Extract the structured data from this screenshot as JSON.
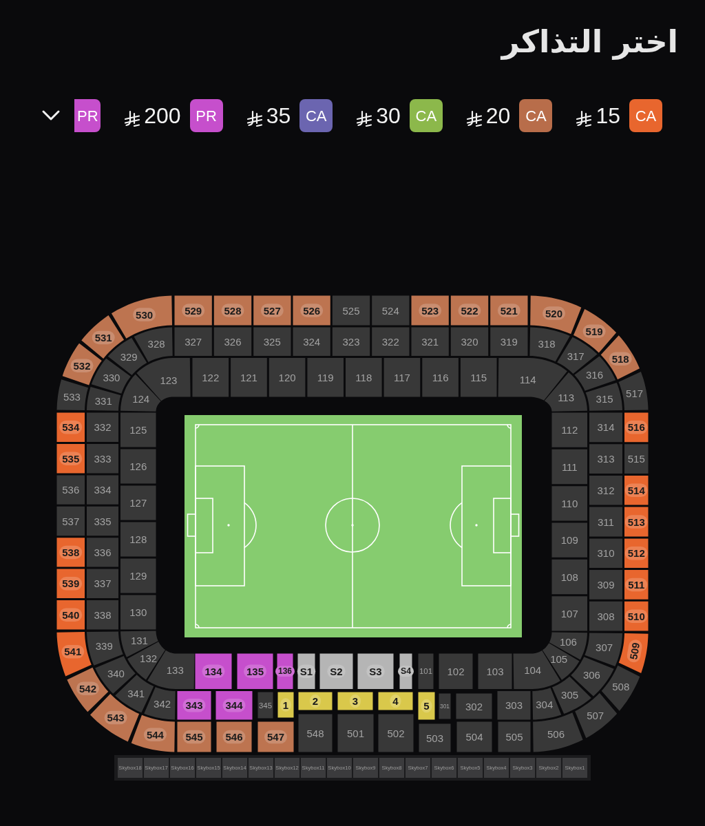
{
  "title": "اختر التذاكر",
  "price_filters": [
    {
      "tag": "PR",
      "color": "#c64fcc"
    },
    {
      "tag": "PR",
      "price": "200",
      "color": "#c64fcc"
    },
    {
      "tag": "CA",
      "price": "35",
      "color": "#6b65b0"
    },
    {
      "tag": "CA",
      "price": "30",
      "color": "#8cb84b"
    },
    {
      "tag": "CA",
      "price": "20",
      "color": "#b86d4a"
    },
    {
      "tag": "CA",
      "price": "15",
      "color": "#e8662e"
    }
  ],
  "seat_map": {
    "sections": [
      {
        "label": "533",
        "available": false,
        "color": "#383838"
      },
      {
        "label": "532",
        "available": true,
        "color": "#bd7450"
      },
      {
        "label": "531",
        "available": true,
        "color": "#bd7450"
      },
      {
        "label": "530",
        "available": true,
        "color": "#bd7450"
      },
      {
        "label": "529",
        "available": true,
        "color": "#bd7450"
      },
      {
        "label": "528",
        "available": true,
        "color": "#bd7450"
      },
      {
        "label": "527",
        "available": true,
        "color": "#bd7450"
      },
      {
        "label": "526",
        "available": true,
        "color": "#bd7450"
      },
      {
        "label": "525",
        "available": false,
        "color": "#383838"
      },
      {
        "label": "524",
        "available": false,
        "color": "#383838"
      },
      {
        "label": "523",
        "available": true,
        "color": "#bd7450"
      },
      {
        "label": "522",
        "available": true,
        "color": "#bd7450"
      },
      {
        "label": "521",
        "available": true,
        "color": "#bd7450"
      },
      {
        "label": "520",
        "available": true,
        "color": "#bd7450"
      },
      {
        "label": "519",
        "available": true,
        "color": "#bd7450"
      },
      {
        "label": "518",
        "available": true,
        "color": "#bd7450"
      },
      {
        "label": "517",
        "available": false,
        "color": "#383838"
      },
      {
        "label": "534",
        "available": true,
        "color": "#e8662e"
      },
      {
        "label": "535",
        "available": true,
        "color": "#e8662e"
      },
      {
        "label": "536",
        "available": false,
        "color": "#383838"
      },
      {
        "label": "537",
        "available": false,
        "color": "#383838"
      },
      {
        "label": "538",
        "available": true,
        "color": "#e8662e"
      },
      {
        "label": "539",
        "available": true,
        "color": "#e8662e"
      },
      {
        "label": "540",
        "available": true,
        "color": "#e8662e"
      },
      {
        "label": "516",
        "available": true,
        "color": "#e8662e"
      },
      {
        "label": "515",
        "available": false,
        "color": "#383838"
      },
      {
        "label": "514",
        "available": true,
        "color": "#e8662e"
      },
      {
        "label": "513",
        "available": true,
        "color": "#e8662e"
      },
      {
        "label": "512",
        "available": true,
        "color": "#e8662e"
      },
      {
        "label": "511",
        "available": true,
        "color": "#e8662e"
      },
      {
        "label": "510",
        "available": true,
        "color": "#e8662e"
      },
      {
        "label": "541",
        "available": true,
        "color": "#e8662e"
      },
      {
        "label": "542",
        "available": true,
        "color": "#bd7450"
      },
      {
        "label": "543",
        "available": true,
        "color": "#bd7450"
      },
      {
        "label": "544",
        "available": true,
        "color": "#bd7450"
      },
      {
        "label": "545",
        "available": true,
        "color": "#bd7450"
      },
      {
        "label": "546",
        "available": true,
        "color": "#bd7450"
      },
      {
        "label": "547",
        "available": true,
        "color": "#bd7450"
      },
      {
        "label": "548",
        "available": false,
        "color": "#383838"
      },
      {
        "label": "501",
        "available": false,
        "color": "#383838"
      },
      {
        "label": "502",
        "available": false,
        "color": "#383838"
      },
      {
        "label": "503",
        "available": false,
        "color": "#383838"
      },
      {
        "label": "504",
        "available": false,
        "color": "#383838"
      },
      {
        "label": "505",
        "available": false,
        "color": "#383838"
      },
      {
        "label": "506",
        "available": false,
        "color": "#383838"
      },
      {
        "label": "507",
        "available": false,
        "color": "#383838"
      },
      {
        "label": "508",
        "available": false,
        "color": "#383838"
      },
      {
        "label": "509",
        "available": true,
        "color": "#e8662e"
      },
      {
        "label": "331",
        "available": false,
        "color": "#383838"
      },
      {
        "label": "330",
        "available": false,
        "color": "#383838"
      },
      {
        "label": "329",
        "available": false,
        "color": "#383838"
      },
      {
        "label": "328",
        "available": false,
        "color": "#383838"
      },
      {
        "label": "327",
        "available": false,
        "color": "#383838"
      },
      {
        "label": "326",
        "available": false,
        "color": "#383838"
      },
      {
        "label": "325",
        "available": false,
        "color": "#383838"
      },
      {
        "label": "324",
        "available": false,
        "color": "#383838"
      },
      {
        "label": "323",
        "available": false,
        "color": "#383838"
      },
      {
        "label": "322",
        "available": false,
        "color": "#383838"
      },
      {
        "label": "321",
        "available": false,
        "color": "#383838"
      },
      {
        "label": "320",
        "available": false,
        "color": "#383838"
      },
      {
        "label": "319",
        "available": false,
        "color": "#383838"
      },
      {
        "label": "318",
        "available": false,
        "color": "#383838"
      },
      {
        "label": "317",
        "available": false,
        "color": "#383838"
      },
      {
        "label": "316",
        "available": false,
        "color": "#383838"
      },
      {
        "label": "315",
        "available": false,
        "color": "#383838"
      },
      {
        "label": "332",
        "available": false,
        "color": "#383838"
      },
      {
        "label": "333",
        "available": false,
        "color": "#383838"
      },
      {
        "label": "334",
        "available": false,
        "color": "#383838"
      },
      {
        "label": "335",
        "available": false,
        "color": "#383838"
      },
      {
        "label": "336",
        "available": false,
        "color": "#383838"
      },
      {
        "label": "337",
        "available": false,
        "color": "#383838"
      },
      {
        "label": "338",
        "available": false,
        "color": "#383838"
      },
      {
        "label": "314",
        "available": false,
        "color": "#383838"
      },
      {
        "label": "313",
        "available": false,
        "color": "#383838"
      },
      {
        "label": "312",
        "available": false,
        "color": "#383838"
      },
      {
        "label": "311",
        "available": false,
        "color": "#383838"
      },
      {
        "label": "310",
        "available": false,
        "color": "#383838"
      },
      {
        "label": "309",
        "available": false,
        "color": "#383838"
      },
      {
        "label": "308",
        "available": false,
        "color": "#383838"
      },
      {
        "label": "339",
        "available": false,
        "color": "#383838"
      },
      {
        "label": "340",
        "available": false,
        "color": "#383838"
      },
      {
        "label": "341",
        "available": false,
        "color": "#383838"
      },
      {
        "label": "342",
        "available": false,
        "color": "#383838"
      },
      {
        "label": "343",
        "available": true,
        "color": "#c64fcc"
      },
      {
        "label": "344",
        "available": true,
        "color": "#c64fcc"
      },
      {
        "label": "345",
        "available": false,
        "color": "#383838"
      },
      {
        "label": "1",
        "available": true,
        "color": "#d9c84b"
      },
      {
        "label": "2",
        "available": true,
        "color": "#d9c84b"
      },
      {
        "label": "3",
        "available": true,
        "color": "#d9c84b"
      },
      {
        "label": "4",
        "available": true,
        "color": "#d9c84b"
      },
      {
        "label": "5",
        "available": true,
        "color": "#d9c84b"
      },
      {
        "label": "301",
        "available": false,
        "color": "#383838"
      },
      {
        "label": "302",
        "available": false,
        "color": "#383838"
      },
      {
        "label": "303",
        "available": false,
        "color": "#383838"
      },
      {
        "label": "304",
        "available": false,
        "color": "#383838"
      },
      {
        "label": "305",
        "available": false,
        "color": "#383838"
      },
      {
        "label": "306",
        "available": false,
        "color": "#383838"
      },
      {
        "label": "307",
        "available": false,
        "color": "#383838"
      },
      {
        "label": "124",
        "available": false,
        "color": "#383838"
      },
      {
        "label": "123",
        "available": false,
        "color": "#383838"
      },
      {
        "label": "122",
        "available": false,
        "color": "#383838"
      },
      {
        "label": "121",
        "available": false,
        "color": "#383838"
      },
      {
        "label": "120",
        "available": false,
        "color": "#383838"
      },
      {
        "label": "119",
        "available": false,
        "color": "#383838"
      },
      {
        "label": "118",
        "available": false,
        "color": "#383838"
      },
      {
        "label": "117",
        "available": false,
        "color": "#383838"
      },
      {
        "label": "116",
        "available": false,
        "color": "#383838"
      },
      {
        "label": "115",
        "available": false,
        "color": "#383838"
      },
      {
        "label": "114",
        "available": false,
        "color": "#383838"
      },
      {
        "label": "113",
        "available": false,
        "color": "#383838"
      },
      {
        "label": "125",
        "available": false,
        "color": "#383838"
      },
      {
        "label": "126",
        "available": false,
        "color": "#383838"
      },
      {
        "label": "127",
        "available": false,
        "color": "#383838"
      },
      {
        "label": "128",
        "available": false,
        "color": "#383838"
      },
      {
        "label": "129",
        "available": false,
        "color": "#383838"
      },
      {
        "label": "130",
        "available": false,
        "color": "#383838"
      },
      {
        "label": "112",
        "available": false,
        "color": "#383838"
      },
      {
        "label": "111",
        "available": false,
        "color": "#383838"
      },
      {
        "label": "110",
        "available": false,
        "color": "#383838"
      },
      {
        "label": "109",
        "available": false,
        "color": "#383838"
      },
      {
        "label": "108",
        "available": false,
        "color": "#383838"
      },
      {
        "label": "107",
        "available": false,
        "color": "#383838"
      },
      {
        "label": "131",
        "available": false,
        "color": "#383838"
      },
      {
        "label": "132",
        "available": false,
        "color": "#383838"
      },
      {
        "label": "133",
        "available": false,
        "color": "#383838"
      },
      {
        "label": "134",
        "available": true,
        "color": "#c64fcc"
      },
      {
        "label": "135",
        "available": true,
        "color": "#c64fcc"
      },
      {
        "label": "136",
        "available": true,
        "color": "#c64fcc"
      },
      {
        "label": "S1",
        "available": true,
        "color": "#b5b5b5"
      },
      {
        "label": "S2",
        "available": true,
        "color": "#b5b5b5"
      },
      {
        "label": "S3",
        "available": true,
        "color": "#b5b5b5"
      },
      {
        "label": "S4",
        "available": true,
        "color": "#b5b5b5"
      },
      {
        "label": "101",
        "available": false,
        "color": "#383838"
      },
      {
        "label": "102",
        "available": false,
        "color": "#383838"
      },
      {
        "label": "103",
        "available": false,
        "color": "#383838"
      },
      {
        "label": "104",
        "available": false,
        "color": "#383838"
      },
      {
        "label": "105",
        "available": false,
        "color": "#383838"
      },
      {
        "label": "106",
        "available": false,
        "color": "#383838"
      }
    ],
    "skyboxes": [
      {
        "label": "Skybox18"
      },
      {
        "label": "Skybox17"
      },
      {
        "label": "Skybox16"
      },
      {
        "label": "Skybox15"
      },
      {
        "label": "Skybox14"
      },
      {
        "label": "Skybox13"
      },
      {
        "label": "Skybox12"
      },
      {
        "label": "Skybox11"
      },
      {
        "label": "Skybox10"
      },
      {
        "label": "Skybox9"
      },
      {
        "label": "Skybox8"
      },
      {
        "label": "Skybox7"
      },
      {
        "label": "Skybox6"
      },
      {
        "label": "Skybox5"
      },
      {
        "label": "Skybox4"
      },
      {
        "label": "Skybox3"
      },
      {
        "label": "Skybox2"
      },
      {
        "label": "Skybox1"
      }
    ]
  }
}
